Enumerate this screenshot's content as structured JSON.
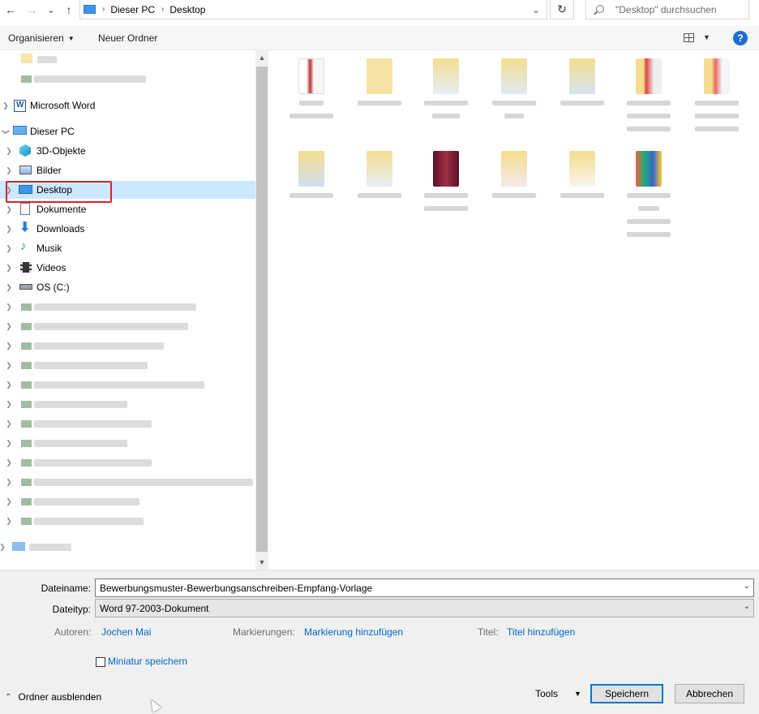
{
  "address_bar": {
    "back": "←",
    "forward": "→",
    "recent": "⌄",
    "up": "↑",
    "crumbs": [
      "Dieser PC",
      "Desktop"
    ],
    "refresh": "↻",
    "search_placeholder": "\"Desktop\" durchsuchen"
  },
  "toolbar": {
    "organize": "Organisieren",
    "new_folder": "Neuer Ordner",
    "help": "?"
  },
  "tree": {
    "word": "Microsoft Word",
    "this_pc": "Dieser PC",
    "objects3d": "3D-Objekte",
    "pictures": "Bilder",
    "desktop": "Desktop",
    "documents": "Dokumente",
    "downloads": "Downloads",
    "music": "Musik",
    "videos": "Videos",
    "os": "OS (C:)"
  },
  "form": {
    "filename_label": "Dateiname:",
    "filename_value": "Bewerbungsmuster-Bewerbungsanschreiben-Empfang-Vorlage",
    "filetype_label": "Dateityp:",
    "filetype_value": "Word 97-2003-Dokument",
    "authors_label": "Autoren:",
    "authors_value": "Jochen Mai",
    "tags_label": "Markierungen:",
    "tags_value": "Markierung hinzufügen",
    "title_label": "Titel:",
    "title_value": "Titel hinzufügen",
    "thumbnail_label": "Miniatur speichern"
  },
  "footer": {
    "hide_folders": "Ordner ausblenden",
    "tools": "Tools",
    "save": "Speichern",
    "cancel": "Abbrechen"
  },
  "colors": {
    "selection": "#cce8ff",
    "highlight": "#d9232b",
    "link": "#0066cc",
    "primary_border": "#0078d7"
  }
}
